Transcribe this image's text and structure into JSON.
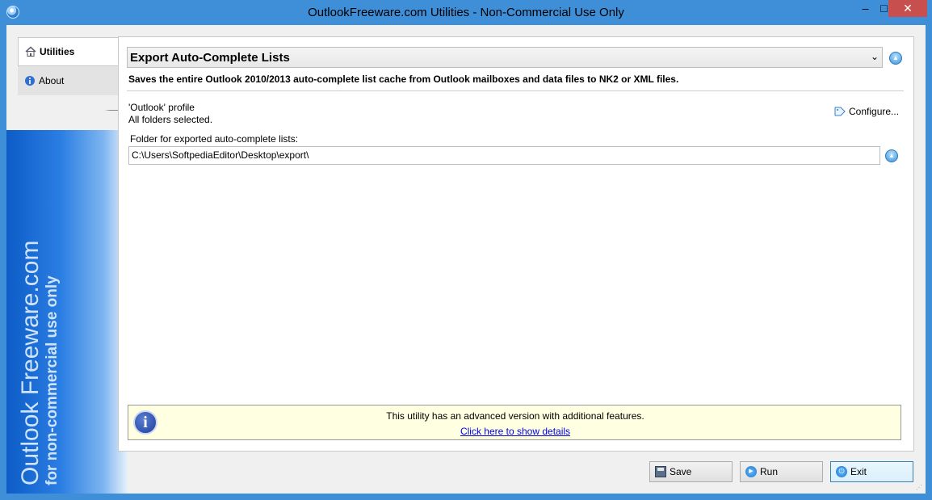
{
  "window": {
    "title": "OutlookFreeware.com Utilities - Non-Commercial Use Only",
    "minimize_glyph": "–",
    "maximize_glyph": "□",
    "close_glyph": "✕"
  },
  "sidebar": {
    "items": [
      {
        "label": "Utilities",
        "icon": "home-icon",
        "active": true
      },
      {
        "label": "About",
        "icon": "info-icon",
        "active": false
      }
    ],
    "brand_line1": "Outlook Freeware.com",
    "brand_line2": "for non-commercial use only"
  },
  "main": {
    "utility_select": "Export Auto-Complete Lists",
    "dropdown_arrow": "⌄",
    "description": "Saves the entire Outlook 2010/2013 auto-complete list cache from Outlook mailboxes and data files to NK2 or XML files.",
    "profile_line1": "'Outlook' profile",
    "profile_line2": "All folders selected.",
    "configure_label": "Configure...",
    "folder_label": "Folder for exported auto-complete lists:",
    "folder_value": "C:\\Users\\SoftpediaEditor\\Desktop\\export\\"
  },
  "infobox": {
    "icon_glyph": "i",
    "text": "This utility has an advanced version with additional features.",
    "link": "Click here to show details"
  },
  "buttons": {
    "save": "Save",
    "run": "Run",
    "exit": "Exit"
  },
  "colors": {
    "titlebar": "#3f8fd8",
    "close_button": "#c7504f",
    "sidebar_dark": "#0d5cc7",
    "infobox_bg": "#ffffe1",
    "link": "#0000ee"
  }
}
